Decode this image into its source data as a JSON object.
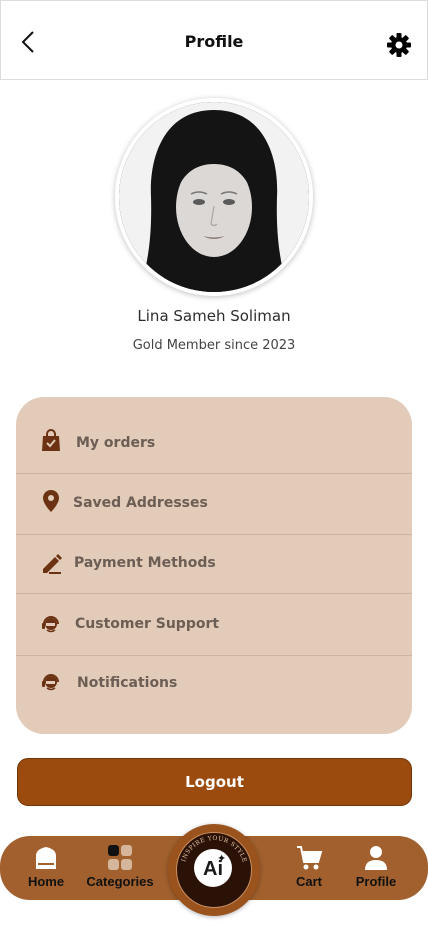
{
  "header": {
    "title": "Profile",
    "back_icon": "chevron-left-icon",
    "settings_icon": "gear-icon"
  },
  "profile": {
    "name": "Lina Sameh Soliman",
    "membership": "Gold Member since 2023"
  },
  "menu": {
    "items": [
      {
        "label": "My orders",
        "icon": "shopping-bag-icon"
      },
      {
        "label": "Saved Addresses",
        "icon": "location-pin-icon"
      },
      {
        "label": "Payment Methods",
        "icon": "pen-icon"
      },
      {
        "label": "Customer Support",
        "icon": "support-agent-icon"
      },
      {
        "label": "Notifications",
        "icon": "support-agent-icon"
      }
    ]
  },
  "logout": {
    "label": "Logout"
  },
  "bottom_nav": {
    "items": [
      {
        "label": "Home",
        "icon": "home-icon"
      },
      {
        "label": "Categories",
        "icon": "categories-icon"
      },
      {
        "label": "Cart",
        "icon": "cart-icon"
      },
      {
        "label": "Profile",
        "icon": "person-icon"
      }
    ],
    "ai": {
      "label": "Ai",
      "ring_text": "INSPIRE YOUR STYLE"
    }
  },
  "colors": {
    "accent": "#9c4b0f",
    "nav_bg": "#a1602d",
    "card_bg": "#e2cbb8"
  }
}
